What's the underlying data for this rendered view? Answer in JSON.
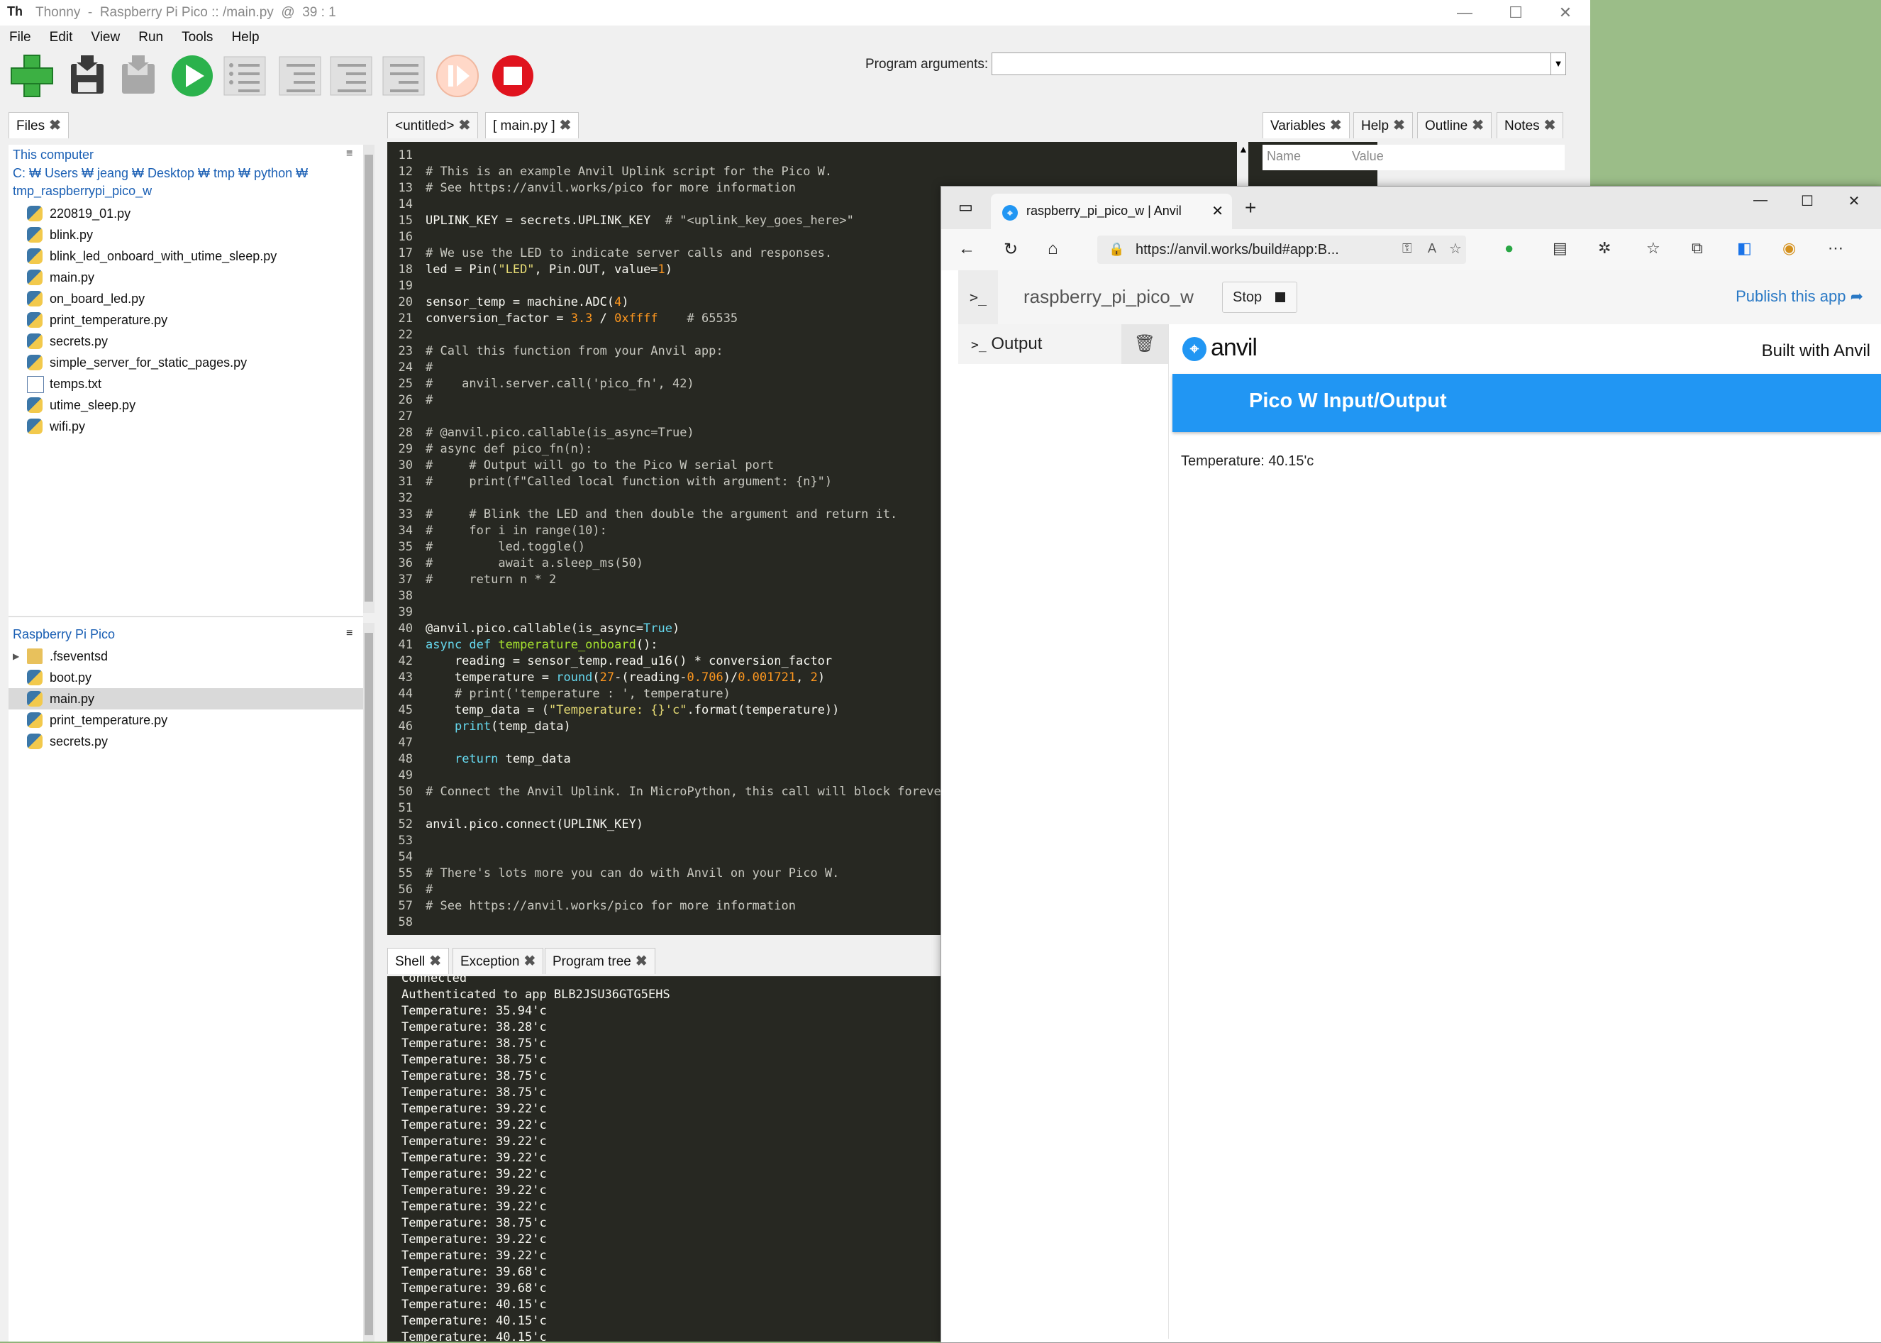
{
  "thonny": {
    "title": "Thonny  -  Raspberry Pi Pico :: /main.py  @  39 : 1",
    "app_icon": "Th",
    "menu": [
      "File",
      "Edit",
      "View",
      "Run",
      "Tools",
      "Help"
    ],
    "program_arguments_label": "Program arguments:",
    "program_arguments_value": "",
    "files_tab": "Files",
    "this_computer": "This computer",
    "path_line1": "C: ₩ Users ₩ jeang ₩ Desktop ₩ tmp ₩ python ₩",
    "path_line2": "tmp_raspberrypi_pico_w",
    "computer_files": [
      {
        "name": "220819_01.py",
        "type": "py"
      },
      {
        "name": "blink.py",
        "type": "py"
      },
      {
        "name": "blink_led_onboard_with_utime_sleep.py",
        "type": "py"
      },
      {
        "name": "main.py",
        "type": "py"
      },
      {
        "name": "on_board_led.py",
        "type": "py"
      },
      {
        "name": "print_temperature.py",
        "type": "py"
      },
      {
        "name": "secrets.py",
        "type": "py"
      },
      {
        "name": "simple_server_for_static_pages.py",
        "type": "py"
      },
      {
        "name": "temps.txt",
        "type": "txt"
      },
      {
        "name": "utime_sleep.py",
        "type": "py"
      },
      {
        "name": "wifi.py",
        "type": "py"
      }
    ],
    "pico_title": "Raspberry Pi Pico",
    "pico_files": [
      {
        "name": ".fseventsd",
        "type": "folder"
      },
      {
        "name": "boot.py",
        "type": "py"
      },
      {
        "name": "main.py",
        "type": "py",
        "selected": true
      },
      {
        "name": "print_temperature.py",
        "type": "py"
      },
      {
        "name": "secrets.py",
        "type": "py"
      }
    ],
    "editor_tabs": [
      "<untitled>",
      "[ main.py ]"
    ],
    "right_tabs": [
      "Variables",
      "Help",
      "Outline",
      "Notes"
    ],
    "var_cols": [
      "Name",
      "Value"
    ],
    "shell_tabs": [
      "Shell",
      "Exception",
      "Program tree"
    ],
    "shell_lines": [
      "Connected",
      "Authenticated to app BLB2JSU36GTG5EHS",
      "Temperature: 35.94'c",
      "Temperature: 38.28'c",
      "Temperature: 38.75'c",
      "Temperature: 38.75'c",
      "Temperature: 38.75'c",
      "Temperature: 38.75'c",
      "Temperature: 39.22'c",
      "Temperature: 39.22'c",
      "Temperature: 39.22'c",
      "Temperature: 39.22'c",
      "Temperature: 39.22'c",
      "Temperature: 39.22'c",
      "Temperature: 39.22'c",
      "Temperature: 38.75'c",
      "Temperature: 39.22'c",
      "Temperature: 39.22'c",
      "Temperature: 39.68'c",
      "Temperature: 39.68'c",
      "Temperature: 40.15'c",
      "Temperature: 40.15'c",
      "Temperature: 40.15'c"
    ],
    "code_lines": [
      {
        "n": "11",
        "s": [
          [
            "t",
            ""
          ]
        ]
      },
      {
        "n": "12",
        "s": [
          [
            "c",
            "# This is an example Anvil Uplink script for the Pico W."
          ]
        ]
      },
      {
        "n": "13",
        "s": [
          [
            "c",
            "# See https://anvil.works/pico for more information"
          ]
        ]
      },
      {
        "n": "14",
        "s": [
          [
            "t",
            ""
          ]
        ]
      },
      {
        "n": "15",
        "s": [
          [
            "t",
            "UPLINK_KEY = secrets.UPLINK_KEY  "
          ],
          [
            "c",
            "# \"<uplink_key_goes_here>\""
          ]
        ]
      },
      {
        "n": "16",
        "s": [
          [
            "t",
            ""
          ]
        ]
      },
      {
        "n": "17",
        "s": [
          [
            "c",
            "# We use the LED to indicate server calls and responses."
          ]
        ]
      },
      {
        "n": "18",
        "s": [
          [
            "t",
            "led = Pin("
          ],
          [
            "s",
            "\"LED\""
          ],
          [
            "t",
            ", Pin.OUT, value="
          ],
          [
            "n",
            "1"
          ],
          [
            "t",
            ")"
          ]
        ]
      },
      {
        "n": "19",
        "s": [
          [
            "t",
            ""
          ]
        ]
      },
      {
        "n": "20",
        "s": [
          [
            "t",
            "sensor_temp = machine.ADC("
          ],
          [
            "n",
            "4"
          ],
          [
            "t",
            ")"
          ]
        ]
      },
      {
        "n": "21",
        "s": [
          [
            "t",
            "conversion_factor = "
          ],
          [
            "n",
            "3.3"
          ],
          [
            "t",
            " / "
          ],
          [
            "n",
            "0xffff"
          ],
          [
            "t",
            "    "
          ],
          [
            "c",
            "# 65535"
          ]
        ]
      },
      {
        "n": "22",
        "s": [
          [
            "t",
            ""
          ]
        ]
      },
      {
        "n": "23",
        "s": [
          [
            "c",
            "# Call this function from your Anvil app:"
          ]
        ]
      },
      {
        "n": "24",
        "s": [
          [
            "c",
            "#"
          ]
        ]
      },
      {
        "n": "25",
        "s": [
          [
            "c",
            "#    anvil.server.call('pico_fn', 42)"
          ]
        ]
      },
      {
        "n": "26",
        "s": [
          [
            "c",
            "#"
          ]
        ]
      },
      {
        "n": "27",
        "s": [
          [
            "t",
            ""
          ]
        ]
      },
      {
        "n": "28",
        "s": [
          [
            "c",
            "# @anvil.pico.callable(is_async=True)"
          ]
        ]
      },
      {
        "n": "29",
        "s": [
          [
            "c",
            "# async def pico_fn(n):"
          ]
        ]
      },
      {
        "n": "30",
        "s": [
          [
            "c",
            "#     # Output will go to the Pico W serial port"
          ]
        ]
      },
      {
        "n": "31",
        "s": [
          [
            "c",
            "#     print(f\"Called local function with argument: {n}\")"
          ]
        ]
      },
      {
        "n": "32",
        "s": [
          [
            "t",
            ""
          ]
        ]
      },
      {
        "n": "33",
        "s": [
          [
            "c",
            "#     # Blink the LED and then double the argument and return it."
          ]
        ]
      },
      {
        "n": "34",
        "s": [
          [
            "c",
            "#     for i in range(10):"
          ]
        ]
      },
      {
        "n": "35",
        "s": [
          [
            "c",
            "#         led.toggle()"
          ]
        ]
      },
      {
        "n": "36",
        "s": [
          [
            "c",
            "#         await a.sleep_ms(50)"
          ]
        ]
      },
      {
        "n": "37",
        "s": [
          [
            "c",
            "#     return n * 2"
          ]
        ]
      },
      {
        "n": "38",
        "s": [
          [
            "t",
            ""
          ]
        ]
      },
      {
        "n": "39",
        "s": [
          [
            "t",
            ""
          ]
        ]
      },
      {
        "n": "40",
        "s": [
          [
            "t",
            "@anvil.pico.callable(is_async="
          ],
          [
            "k",
            "True"
          ],
          [
            "t",
            ")"
          ]
        ]
      },
      {
        "n": "41",
        "s": [
          [
            "k",
            "async def "
          ],
          [
            "f",
            "temperature_onboard"
          ],
          [
            "t",
            "():"
          ]
        ]
      },
      {
        "n": "42",
        "s": [
          [
            "t",
            "    reading = sensor_temp.read_u16() * conversion_factor"
          ]
        ]
      },
      {
        "n": "43",
        "s": [
          [
            "t",
            "    temperature = "
          ],
          [
            "k",
            "round"
          ],
          [
            "t",
            "("
          ],
          [
            "n",
            "27"
          ],
          [
            "t",
            "-(reading-"
          ],
          [
            "n",
            "0.706"
          ],
          [
            "t",
            ")/"
          ],
          [
            "n",
            "0.001721"
          ],
          [
            "t",
            ", "
          ],
          [
            "n",
            "2"
          ],
          [
            "t",
            ")"
          ]
        ]
      },
      {
        "n": "44",
        "s": [
          [
            "t",
            "    "
          ],
          [
            "c",
            "# print('temperature : ', temperature)"
          ]
        ]
      },
      {
        "n": "45",
        "s": [
          [
            "t",
            "    temp_data = ("
          ],
          [
            "s",
            "\"Temperature: {}'c\""
          ],
          [
            "t",
            ".format(temperature))"
          ]
        ]
      },
      {
        "n": "46",
        "s": [
          [
            "t",
            "    "
          ],
          [
            "k",
            "print"
          ],
          [
            "t",
            "(temp_data)"
          ]
        ]
      },
      {
        "n": "47",
        "s": [
          [
            "t",
            ""
          ]
        ]
      },
      {
        "n": "48",
        "s": [
          [
            "t",
            "    "
          ],
          [
            "k",
            "return"
          ],
          [
            "t",
            " temp_data"
          ]
        ]
      },
      {
        "n": "49",
        "s": [
          [
            "t",
            ""
          ]
        ]
      },
      {
        "n": "50",
        "s": [
          [
            "c",
            "# Connect the Anvil Uplink. In MicroPython, this call will block forever"
          ]
        ]
      },
      {
        "n": "51",
        "s": [
          [
            "t",
            ""
          ]
        ]
      },
      {
        "n": "52",
        "s": [
          [
            "t",
            "anvil.pico.connect(UPLINK_KEY)"
          ]
        ]
      },
      {
        "n": "53",
        "s": [
          [
            "t",
            ""
          ]
        ]
      },
      {
        "n": "54",
        "s": [
          [
            "t",
            ""
          ]
        ]
      },
      {
        "n": "55",
        "s": [
          [
            "c",
            "# There's lots more you can do with Anvil on your Pico W."
          ]
        ]
      },
      {
        "n": "56",
        "s": [
          [
            "c",
            "#"
          ]
        ]
      },
      {
        "n": "57",
        "s": [
          [
            "c",
            "# See https://anvil.works/pico for more information"
          ]
        ]
      },
      {
        "n": "58",
        "s": [
          [
            "t",
            ""
          ]
        ]
      }
    ]
  },
  "browser": {
    "tab_title": "raspberry_pi_pico_w | Anvil",
    "url": "https://anvil.works/build#app:B...",
    "url_host": "anvil.works",
    "anvil": {
      "app_name": "raspberry_pi_pico_w",
      "stop_label": "Stop",
      "publish_label": "Publish this app",
      "output_label": "Output",
      "logo_word": "anvil",
      "built_with": "Built with Anvil",
      "header_title": "Pico W Input/Output",
      "temperature_text": "Temperature: 40.15'c"
    },
    "accent_color": "#2196f3"
  }
}
